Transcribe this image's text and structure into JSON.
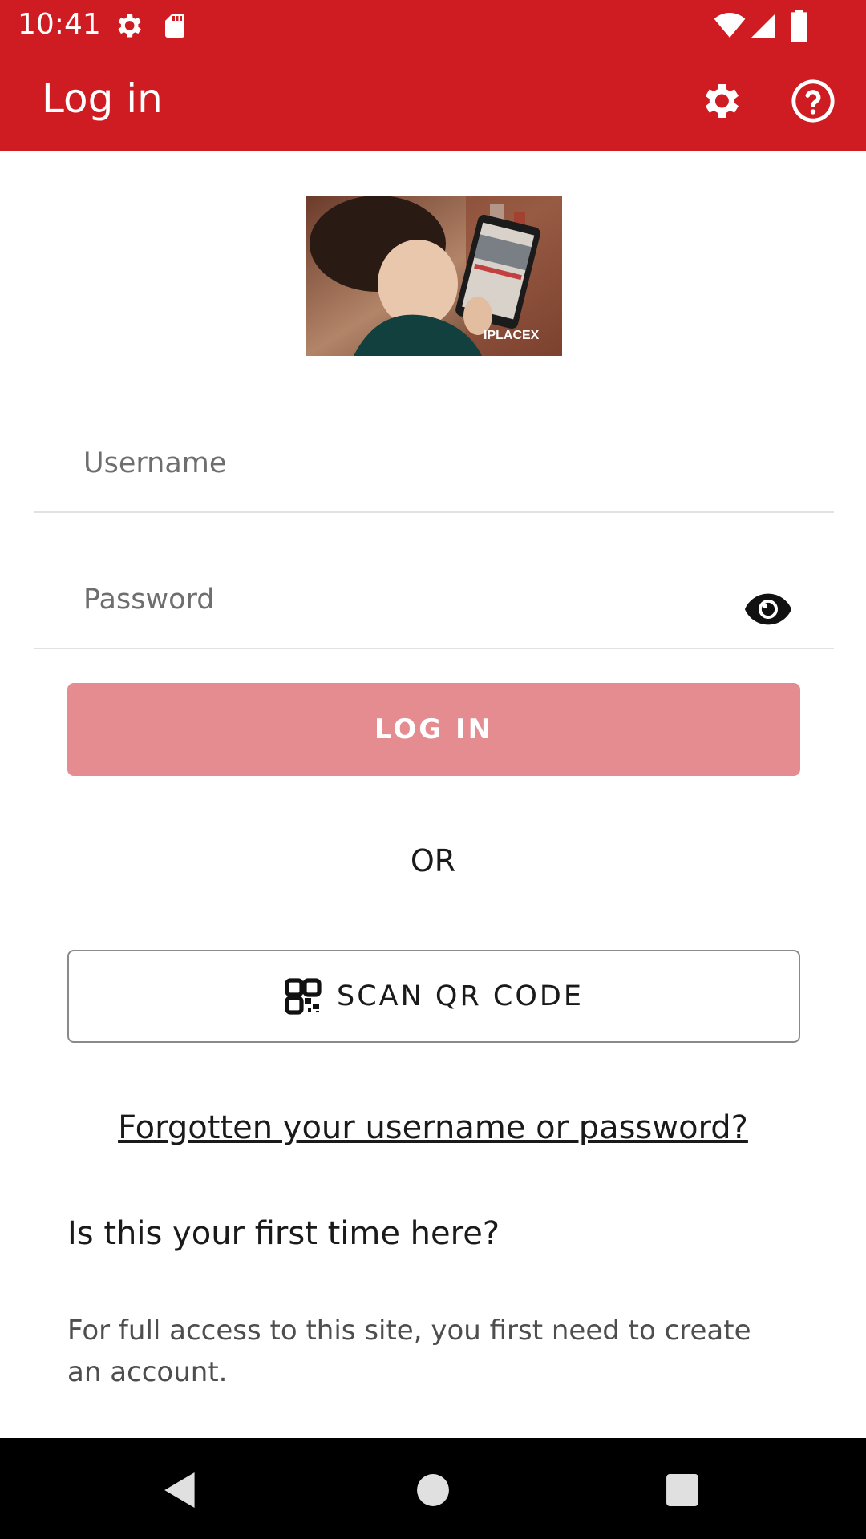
{
  "status_bar": {
    "time": "10:41",
    "left_icons": [
      "settings-icon",
      "sd-card-icon"
    ],
    "right_icons": [
      "wifi-icon",
      "signal-icon",
      "battery-icon"
    ]
  },
  "app_bar": {
    "title": "Log in",
    "background": "#cf1c22",
    "actions": [
      "settings-icon",
      "help-icon"
    ]
  },
  "hero": {
    "description_icon": "site-logo-image",
    "watermark": "IPLACEX"
  },
  "form": {
    "username_placeholder": "Username",
    "password_placeholder": "Password",
    "show_password_icon": "eye-icon",
    "login_label": "LOG IN",
    "login_color": "#e48c8f"
  },
  "divider_text": "OR",
  "qr": {
    "icon": "qr-code-icon",
    "label": "SCAN QR CODE"
  },
  "forgot_link": "Forgotten your username or password?",
  "signup": {
    "heading": "Is this your first time here?",
    "text": "For full access to this site, you first need to create an account."
  },
  "nav_bar": {
    "buttons": [
      "back-icon",
      "home-icon",
      "recents-icon"
    ]
  }
}
